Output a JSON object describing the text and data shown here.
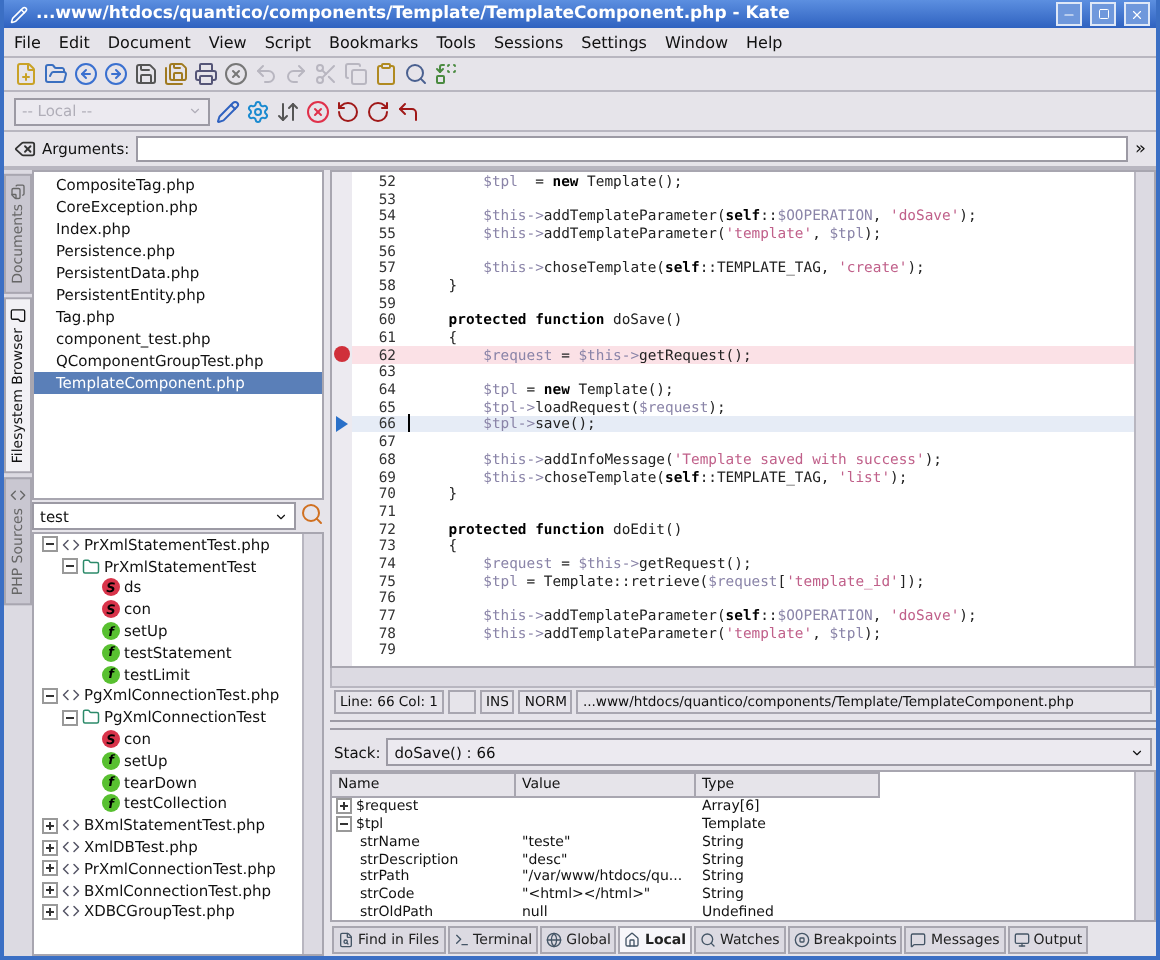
{
  "window": {
    "title": "...www/htdocs/quantico/components/Template/TemplateComponent.php - Kate"
  },
  "menu": [
    "File",
    "Edit",
    "Document",
    "View",
    "Script",
    "Bookmarks",
    "Tools",
    "Sessions",
    "Settings",
    "Window",
    "Help"
  ],
  "debug_toolbar": {
    "site_combo": {
      "value": "-- Local --",
      "disabled": true
    }
  },
  "arguments": {
    "label": "Arguments:",
    "more": "»"
  },
  "side_tabs": [
    {
      "label": "Documents",
      "selected": false
    },
    {
      "label": "Filesystem Browser",
      "selected": true
    },
    {
      "label": "PHP Sources",
      "selected": false
    }
  ],
  "files": [
    {
      "name": "CompositeTag.php",
      "selected": false
    },
    {
      "name": "CoreException.php",
      "selected": false
    },
    {
      "name": "Index.php",
      "selected": false
    },
    {
      "name": "Persistence.php",
      "selected": false
    },
    {
      "name": "PersistentData.php",
      "selected": false
    },
    {
      "name": "PersistentEntity.php",
      "selected": false
    },
    {
      "name": "Tag.php",
      "selected": false
    },
    {
      "name": "component_test.php",
      "selected": false
    },
    {
      "name": "QComponentGroupTest.php",
      "selected": false
    },
    {
      "name": "TemplateComponent.php",
      "selected": true
    }
  ],
  "test_combo": {
    "value": "test"
  },
  "tree": [
    {
      "label": "PrXmlStatementTest.php",
      "kind": "file",
      "expanded": true,
      "children": [
        {
          "label": "PrXmlStatementTest",
          "kind": "class",
          "expanded": true,
          "children": [
            {
              "label": "ds",
              "kind": "static",
              "badge": "S"
            },
            {
              "label": "con",
              "kind": "static",
              "badge": "S"
            },
            {
              "label": "setUp",
              "kind": "function",
              "badge": "f"
            },
            {
              "label": "testStatement",
              "kind": "function",
              "badge": "f"
            },
            {
              "label": "testLimit",
              "kind": "function",
              "badge": "f"
            }
          ]
        }
      ]
    },
    {
      "label": "PgXmlConnectionTest.php",
      "kind": "file",
      "expanded": true,
      "children": [
        {
          "label": "PgXmlConnectionTest",
          "kind": "class",
          "expanded": true,
          "children": [
            {
              "label": "con",
              "kind": "static",
              "badge": "S"
            },
            {
              "label": "setUp",
              "kind": "function",
              "badge": "f"
            },
            {
              "label": "tearDown",
              "kind": "function",
              "badge": "f"
            },
            {
              "label": "testCollection",
              "kind": "function",
              "badge": "f"
            }
          ]
        }
      ]
    },
    {
      "label": "BXmlStatementTest.php",
      "kind": "file",
      "expanded": false
    },
    {
      "label": "XmlDBTest.php",
      "kind": "file",
      "expanded": false
    },
    {
      "label": "PrXmlConnectionTest.php",
      "kind": "file",
      "expanded": false
    },
    {
      "label": "BXmlConnectionTest.php",
      "kind": "file",
      "expanded": false
    },
    {
      "label": "XDBCGroupTest.php",
      "kind": "file",
      "expanded": false
    }
  ],
  "code": [
    {
      "number": "52",
      "kind": "plain",
      "segments": [
        {
          "kind": "var",
          "text": "        $tpl"
        },
        {
          "kind": "plain",
          "text": "  = "
        },
        {
          "kind": "keyword",
          "text": "new"
        },
        {
          "kind": "plain",
          "text": " Template();"
        }
      ]
    },
    {
      "number": "53",
      "kind": "plain"
    },
    {
      "number": "54",
      "kind": "plain",
      "segments": [
        {
          "kind": "var",
          "text": "        $this->"
        },
        {
          "kind": "plain",
          "text": "addTemplateParameter("
        },
        {
          "kind": "keyword",
          "text": "self"
        },
        {
          "kind": "plain",
          "text": "::"
        },
        {
          "kind": "var",
          "text": "$OOPERATION"
        },
        {
          "kind": "plain",
          "text": ", "
        },
        {
          "kind": "string",
          "text": "'doSave'"
        },
        {
          "kind": "plain",
          "text": ");"
        }
      ]
    },
    {
      "number": "55",
      "kind": "plain",
      "segments": [
        {
          "kind": "var",
          "text": "        $this->"
        },
        {
          "kind": "plain",
          "text": "addTemplateParameter("
        },
        {
          "kind": "string",
          "text": "'template'"
        },
        {
          "kind": "plain",
          "text": ", "
        },
        {
          "kind": "var",
          "text": "$tpl"
        },
        {
          "kind": "plain",
          "text": ");"
        }
      ]
    },
    {
      "number": "56",
      "kind": "plain"
    },
    {
      "number": "57",
      "kind": "plain",
      "segments": [
        {
          "kind": "var",
          "text": "        $this->"
        },
        {
          "kind": "plain",
          "text": "choseTemplate("
        },
        {
          "kind": "keyword",
          "text": "self"
        },
        {
          "kind": "plain",
          "text": "::TEMPLATE_TAG, "
        },
        {
          "kind": "string",
          "text": "'create'"
        },
        {
          "kind": "plain",
          "text": ");"
        }
      ]
    },
    {
      "number": "58",
      "kind": "plain",
      "segments": [
        {
          "kind": "plain",
          "text": "    }"
        }
      ]
    },
    {
      "number": "59",
      "kind": "plain"
    },
    {
      "number": "60",
      "kind": "plain",
      "segments": [
        {
          "kind": "keyword",
          "text": "    protected function"
        },
        {
          "kind": "plain",
          "text": " doSave()"
        }
      ]
    },
    {
      "number": "61",
      "kind": "plain",
      "segments": [
        {
          "kind": "plain",
          "text": "    {"
        }
      ]
    },
    {
      "number": "62",
      "kind": "breakpoint",
      "segments": [
        {
          "kind": "var",
          "text": "        $request"
        },
        {
          "kind": "plain",
          "text": " = "
        },
        {
          "kind": "var",
          "text": "$this->"
        },
        {
          "kind": "plain",
          "text": "getRequest();"
        }
      ]
    },
    {
      "number": "63",
      "kind": "plain"
    },
    {
      "number": "64",
      "kind": "plain",
      "segments": [
        {
          "kind": "var",
          "text": "        $tpl"
        },
        {
          "kind": "plain",
          "text": " = "
        },
        {
          "kind": "keyword",
          "text": "new"
        },
        {
          "kind": "plain",
          "text": " Template();"
        }
      ]
    },
    {
      "number": "65",
      "kind": "plain",
      "segments": [
        {
          "kind": "var",
          "text": "        $tpl->"
        },
        {
          "kind": "plain",
          "text": "loadRequest("
        },
        {
          "kind": "var",
          "text": "$request"
        },
        {
          "kind": "plain",
          "text": ");"
        }
      ]
    },
    {
      "number": "66",
      "kind": "current",
      "segments": [
        {
          "kind": "var",
          "text": "        $tpl->"
        },
        {
          "kind": "plain",
          "text": "save();"
        }
      ]
    },
    {
      "number": "67",
      "kind": "plain"
    },
    {
      "number": "68",
      "kind": "plain",
      "segments": [
        {
          "kind": "var",
          "text": "        $this->"
        },
        {
          "kind": "plain",
          "text": "addInfoMessage("
        },
        {
          "kind": "string",
          "text": "'Template saved with success'"
        },
        {
          "kind": "plain",
          "text": ");"
        }
      ]
    },
    {
      "number": "69",
      "kind": "plain",
      "segments": [
        {
          "kind": "var",
          "text": "        $this->"
        },
        {
          "kind": "plain",
          "text": "choseTemplate("
        },
        {
          "kind": "keyword",
          "text": "self"
        },
        {
          "kind": "plain",
          "text": "::TEMPLATE_TAG, "
        },
        {
          "kind": "string",
          "text": "'list'"
        },
        {
          "kind": "plain",
          "text": ");"
        }
      ]
    },
    {
      "number": "70",
      "kind": "plain",
      "segments": [
        {
          "kind": "plain",
          "text": "    }"
        }
      ]
    },
    {
      "number": "71",
      "kind": "plain"
    },
    {
      "number": "72",
      "kind": "plain",
      "segments": [
        {
          "kind": "keyword",
          "text": "    protected function"
        },
        {
          "kind": "plain",
          "text": " doEdit()"
        }
      ]
    },
    {
      "number": "73",
      "kind": "plain",
      "segments": [
        {
          "kind": "plain",
          "text": "    {"
        }
      ]
    },
    {
      "number": "74",
      "kind": "plain",
      "segments": [
        {
          "kind": "var",
          "text": "        $request"
        },
        {
          "kind": "plain",
          "text": " = "
        },
        {
          "kind": "var",
          "text": "$this->"
        },
        {
          "kind": "plain",
          "text": "getRequest();"
        }
      ]
    },
    {
      "number": "75",
      "kind": "plain",
      "segments": [
        {
          "kind": "var",
          "text": "        $tpl"
        },
        {
          "kind": "plain",
          "text": " = Template::retrieve("
        },
        {
          "kind": "var",
          "text": "$request"
        },
        {
          "kind": "plain",
          "text": "["
        },
        {
          "kind": "string",
          "text": "'template_id'"
        },
        {
          "kind": "plain",
          "text": "]);"
        }
      ]
    },
    {
      "number": "76",
      "kind": "plain"
    },
    {
      "number": "77",
      "kind": "plain",
      "segments": [
        {
          "kind": "var",
          "text": "        $this->"
        },
        {
          "kind": "plain",
          "text": "addTemplateParameter("
        },
        {
          "kind": "keyword",
          "text": "self"
        },
        {
          "kind": "plain",
          "text": "::"
        },
        {
          "kind": "var",
          "text": "$OOPERATION"
        },
        {
          "kind": "plain",
          "text": ", "
        },
        {
          "kind": "string",
          "text": "'doSave'"
        },
        {
          "kind": "plain",
          "text": ");"
        }
      ]
    },
    {
      "number": "78",
      "kind": "plain",
      "segments": [
        {
          "kind": "var",
          "text": "        $this->"
        },
        {
          "kind": "plain",
          "text": "addTemplateParameter("
        },
        {
          "kind": "string",
          "text": "'template'"
        },
        {
          "kind": "plain",
          "text": ", "
        },
        {
          "kind": "var",
          "text": "$tpl"
        },
        {
          "kind": "plain",
          "text": ");"
        }
      ]
    },
    {
      "number": "79",
      "kind": "plain"
    }
  ],
  "status_bar": {
    "position": "Line: 66 Col: 1",
    "insert_mode": "INS",
    "edit_mode": "NORM",
    "path": "...www/htdocs/quantico/components/Template/TemplateComponent.php"
  },
  "stack": {
    "label": "Stack:",
    "value": "doSave() : 66"
  },
  "variables": {
    "columns": [
      "Name",
      "Value",
      "Type"
    ],
    "rows": [
      {
        "name": "$request",
        "type": "Array[6]",
        "expanded": false
      },
      {
        "name": "$tpl",
        "type": "Template",
        "expanded": true,
        "children": [
          {
            "name": "strName",
            "value": "\"teste\"",
            "type": "String"
          },
          {
            "name": "strDescription",
            "value": "\"desc\"",
            "type": "String"
          },
          {
            "name": "strPath",
            "value": "\"/var/www/htdocs/qu...",
            "type": "String"
          },
          {
            "name": "strCode",
            "value": "\"<html></html>\"",
            "type": "String"
          },
          {
            "name": "strOldPath",
            "value": "null",
            "type": "Undefined"
          }
        ]
      }
    ]
  },
  "bottom_tabs": [
    {
      "label": "Find in Files",
      "selected": false
    },
    {
      "label": "Terminal",
      "selected": false
    },
    {
      "label": "Global",
      "selected": false
    },
    {
      "label": "Local",
      "selected": true
    },
    {
      "label": "Watches",
      "selected": false
    },
    {
      "label": "Breakpoints",
      "selected": false
    },
    {
      "label": "Messages",
      "selected": false
    },
    {
      "label": "Output",
      "selected": false
    }
  ]
}
